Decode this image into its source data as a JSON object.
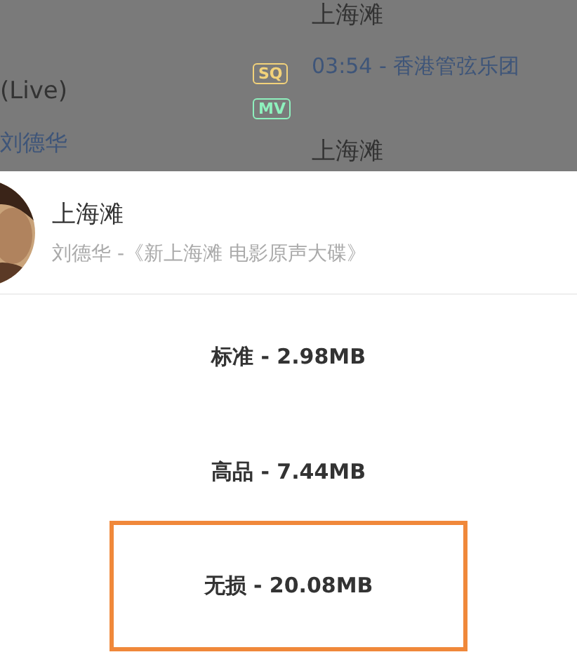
{
  "background_list": {
    "left_items": [
      {
        "kind": "title",
        "text": "(Live)"
      },
      {
        "kind": "artist",
        "text": "刘德华"
      }
    ],
    "badges": [
      {
        "text": "SQ",
        "color": "#f2d27a"
      },
      {
        "text": "MV",
        "color": "#8ef0bd"
      }
    ],
    "right_items": [
      {
        "kind": "title",
        "text": "上海滩"
      },
      {
        "kind": "meta",
        "text": "03:54 - 香港管弦乐团"
      },
      {
        "kind": "title",
        "text": "上海滩"
      }
    ]
  },
  "sheet": {
    "song": {
      "kind": "picture",
      "title": "上海滩",
      "subtitle": "刘德华 -《新上海滩 电影原声大碟》"
    },
    "options": [
      {
        "label": "标准 - 2.98MB",
        "selected": false
      },
      {
        "label": "高品 - 7.44MB",
        "selected": false
      },
      {
        "label": "无损 - 20.08MB",
        "selected": true
      }
    ]
  }
}
